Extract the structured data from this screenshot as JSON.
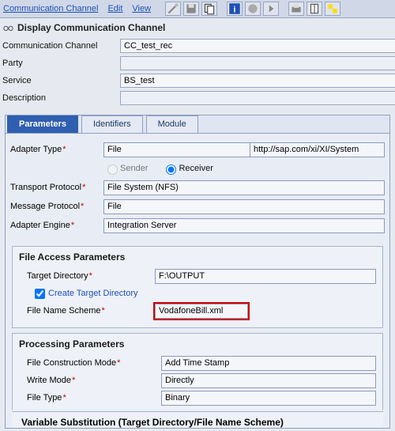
{
  "menubar": {
    "items": [
      "Communication Channel",
      "Edit",
      "View"
    ]
  },
  "title": "Display Communication Channel",
  "header": {
    "fields": {
      "channel_label": "Communication Channel",
      "channel_value": "CC_test_rec",
      "party_label": "Party",
      "party_value": "",
      "service_label": "Service",
      "service_value": "BS_test",
      "description_label": "Description",
      "description_value": ""
    }
  },
  "tabs": {
    "items": [
      "Parameters",
      "Identifiers",
      "Module"
    ],
    "active": 0
  },
  "params": {
    "adapter_type_label": "Adapter Type",
    "adapter_type_value": "File",
    "adapter_ns": "http://sap.com/xi/XI/System",
    "sender_label": "Sender",
    "receiver_label": "Receiver",
    "direction": "receiver",
    "transport_label": "Transport Protocol",
    "transport_value": "File System (NFS)",
    "message_label": "Message Protocol",
    "message_value": "File",
    "engine_label": "Adapter Engine",
    "engine_value": "Integration Server"
  },
  "file_access": {
    "section_title": "File Access Parameters",
    "target_dir_label": "Target Directory",
    "target_dir_value": "F:\\OUTPUT",
    "create_dir_label": "Create Target Directory",
    "create_dir_checked": true,
    "file_scheme_label": "File Name Scheme",
    "file_scheme_value": "VodafoneBill.xml"
  },
  "processing": {
    "section_title": "Processing Parameters",
    "construction_label": "File Construction Mode",
    "construction_value": "Add Time Stamp",
    "write_label": "Write Mode",
    "write_value": "Directly",
    "type_label": "File Type",
    "type_value": "Binary"
  },
  "variable_substitution": "Variable Substitution (Target Directory/File Name Scheme)"
}
